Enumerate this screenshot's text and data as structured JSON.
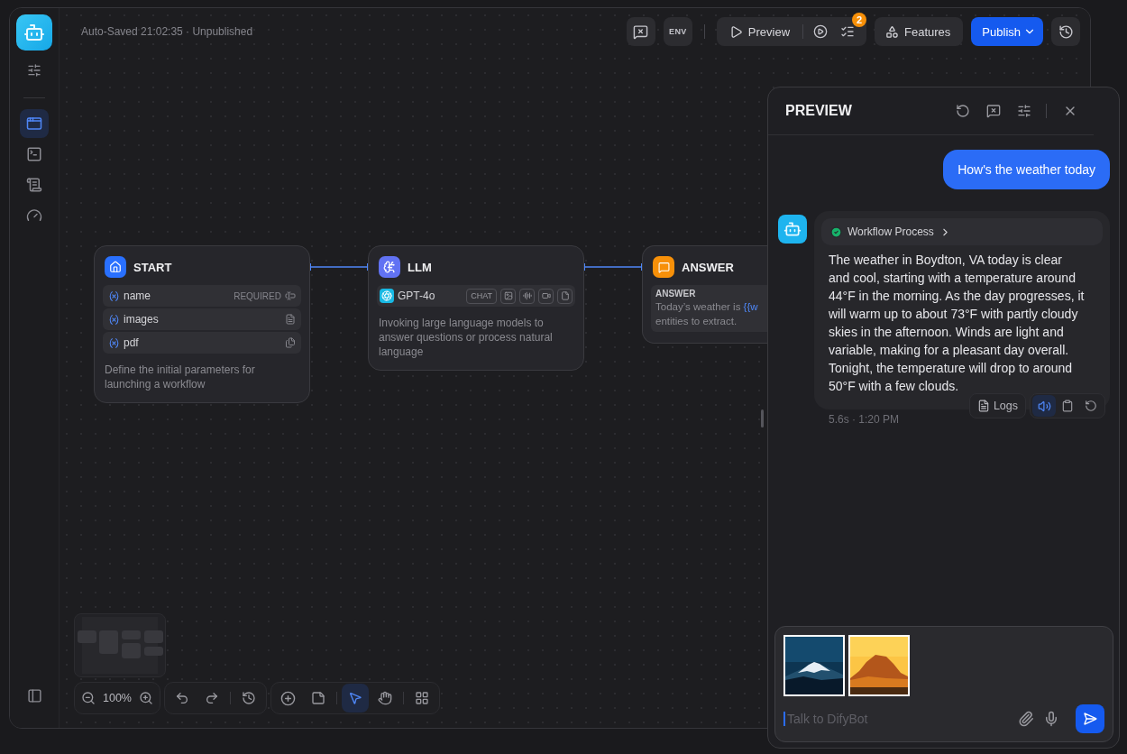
{
  "sidebar": {
    "nav_items": [
      {
        "kind": "orchestrate",
        "selected": true
      },
      {
        "kind": "api",
        "selected": false
      },
      {
        "kind": "logs",
        "selected": false
      },
      {
        "kind": "monitor",
        "selected": false
      }
    ]
  },
  "header": {
    "status": "Auto-Saved 21:02:35 · Unpublished",
    "env_label": "ENV",
    "preview_label": "Preview",
    "checklist_badge": "2",
    "features_label": "Features",
    "publish_label": "Publish"
  },
  "nodes": [
    {
      "kind": "start",
      "title": "START",
      "variables": [
        {
          "name": "name",
          "tag": "REQUIRED",
          "kind": "text"
        },
        {
          "name": "images",
          "kind": "paragraph"
        },
        {
          "name": "pdf",
          "kind": "files"
        }
      ],
      "description": "Define the initial parameters for launching a workflow"
    },
    {
      "kind": "llm",
      "title": "LLM",
      "model": "GPT-4o",
      "mode": "CHAT",
      "description": "Invoking large language models to answer questions or process natural language"
    },
    {
      "kind": "answer",
      "title": "ANSWER",
      "answer_label": "ANSWER",
      "answer_lines": [
        {
          "text": "Today’s weather is ",
          "variable": "{{w"
        },
        {
          "text": "entities to extract."
        }
      ]
    }
  ],
  "canvas_controls": {
    "zoom": "100%",
    "tools": [
      {
        "kind": "pointer",
        "selected": true
      },
      {
        "kind": "hand",
        "selected": false
      }
    ]
  },
  "preview": {
    "title": "PREVIEW",
    "messages": [
      {
        "kind": "user",
        "text": "How's the weather today"
      },
      {
        "kind": "bot",
        "workflow": {
          "label": "Workflow Process",
          "succeeded": true
        },
        "text": "The weather in Boydton, VA today is clear and cool, starting with a temperature around 44°F in the morning. As the day progresses, it will warm up to about 73°F with partly cloudy skies in the afternoon. Winds are light and variable, making for a pleasant day overall. Tonight, the temperature will drop to around 50°F with a few clouds.",
        "meta": "5.6s · 1:20 PM",
        "logs_label": "Logs",
        "speaking": true
      }
    ],
    "input": {
      "placeholder": "Talk to DifyBot"
    }
  }
}
